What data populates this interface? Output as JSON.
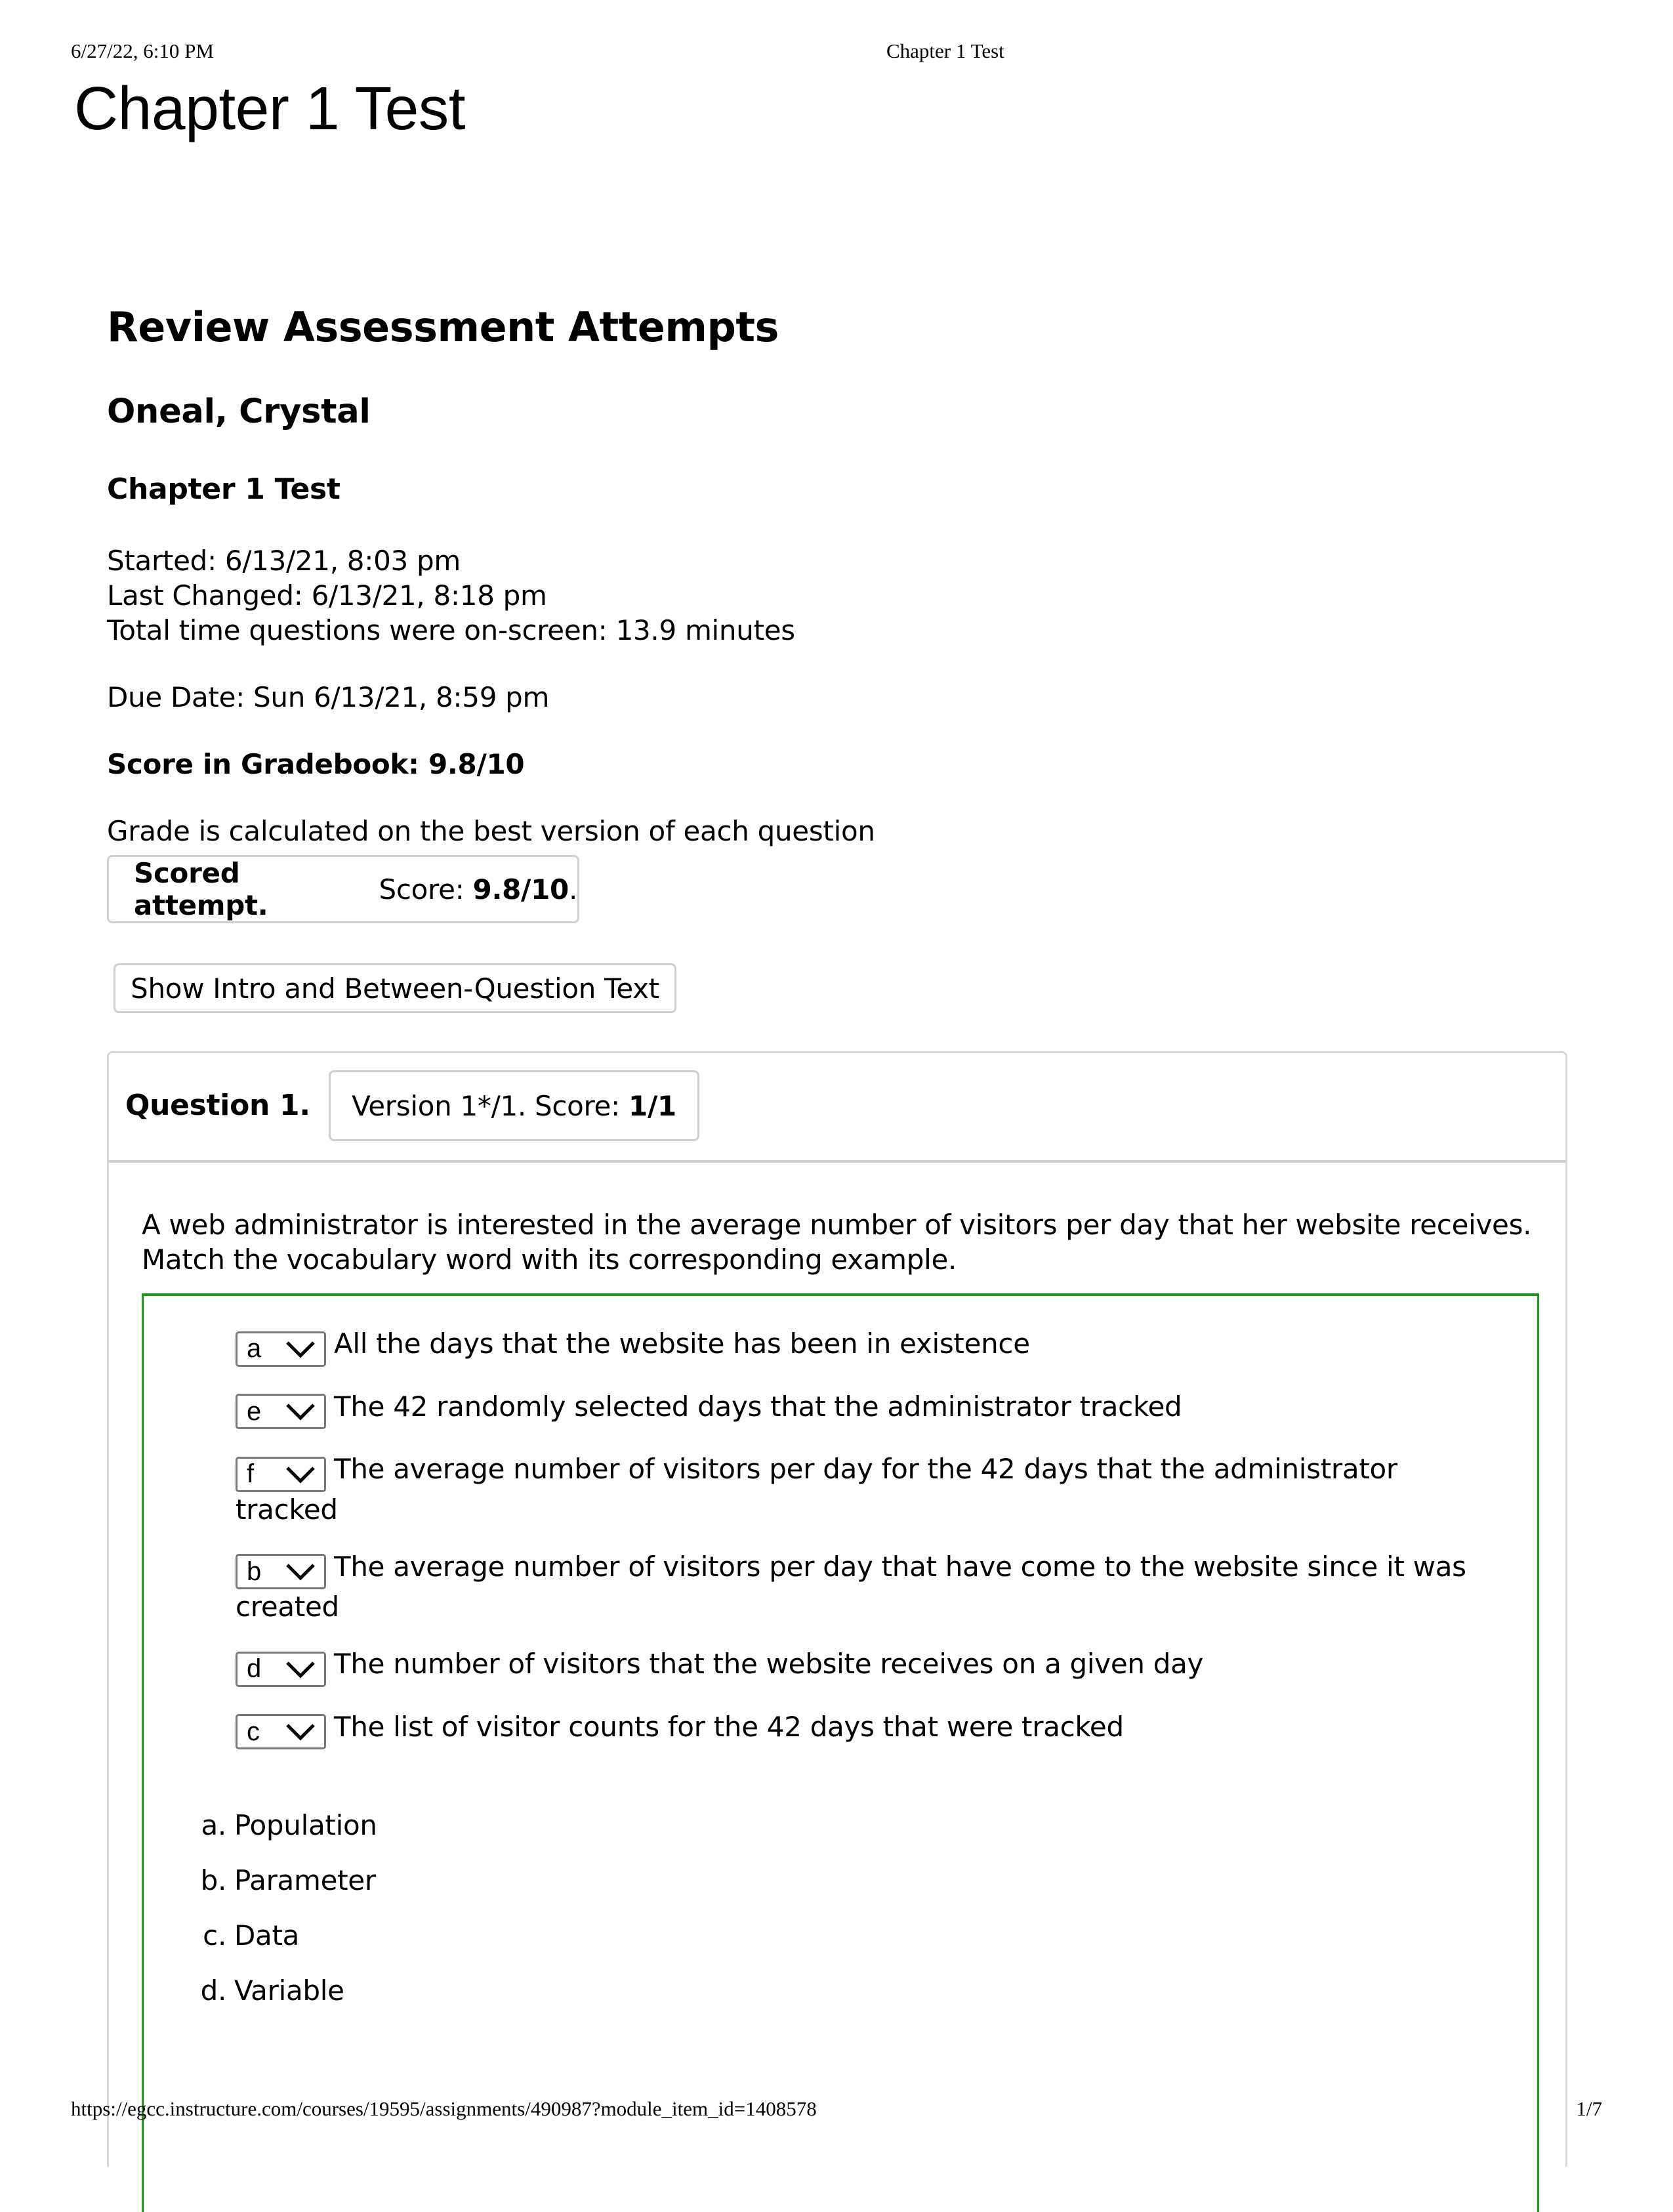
{
  "print_header": {
    "date": "6/27/22, 6:10 PM",
    "doc_title": "Chapter 1 Test"
  },
  "page_title": "Chapter 1 Test",
  "review": {
    "heading": "Review Assessment Attempts",
    "student_name": "Oneal, Crystal",
    "assessment_name": "Chapter 1 Test",
    "started": "Started: 6/13/21, 8:03 pm",
    "last_changed": "Last Changed: 6/13/21, 8:18 pm",
    "total_time": "Total time questions were on-screen: 13.9 minutes",
    "due_date": "Due Date: Sun 6/13/21, 8:59 pm",
    "gradebook_score": "Score in Gradebook: 9.8/10",
    "grade_note": "Grade is calculated on the best version of each question",
    "scored_attempt": {
      "label": "Scored attempt.",
      "score_prefix": "Score:",
      "score_value": "9.8/10",
      "suffix": "."
    },
    "show_intro_button": "Show Intro and Between-Question Text"
  },
  "question": {
    "label": "Question 1.",
    "version_prefix": "Version 1*/1. Score:",
    "version_score": "1/1",
    "text_line1": "A web administrator is interested in the average number of visitors per day that her website receives.",
    "text_line2": "Match the vocabulary word with its corresponding example.",
    "status_color": "#1a9a1a",
    "matches": [
      {
        "selected": "a",
        "text": "All the days that the website has been in existence"
      },
      {
        "selected": "e",
        "text": "The 42 randomly selected days that the administrator tracked"
      },
      {
        "selected": "f",
        "text": "The average number of visitors per day for the 42 days that the administrator tracked"
      },
      {
        "selected": "b",
        "text": "The average number of visitors per day that have come to the website since it was created"
      },
      {
        "selected": "d",
        "text": "The number of visitors that the website receives on a given day"
      },
      {
        "selected": "c",
        "text": "The list of visitor counts for the 42 days that were tracked"
      }
    ],
    "options": [
      {
        "letter": "a.",
        "label": "Population"
      },
      {
        "letter": "b.",
        "label": "Parameter"
      },
      {
        "letter": "c.",
        "label": "Data"
      },
      {
        "letter": "d.",
        "label": "Variable"
      }
    ]
  },
  "print_footer": {
    "url": "https://egcc.instructure.com/courses/19595/assignments/490987?module_item_id=1408578",
    "page": "1/7"
  }
}
